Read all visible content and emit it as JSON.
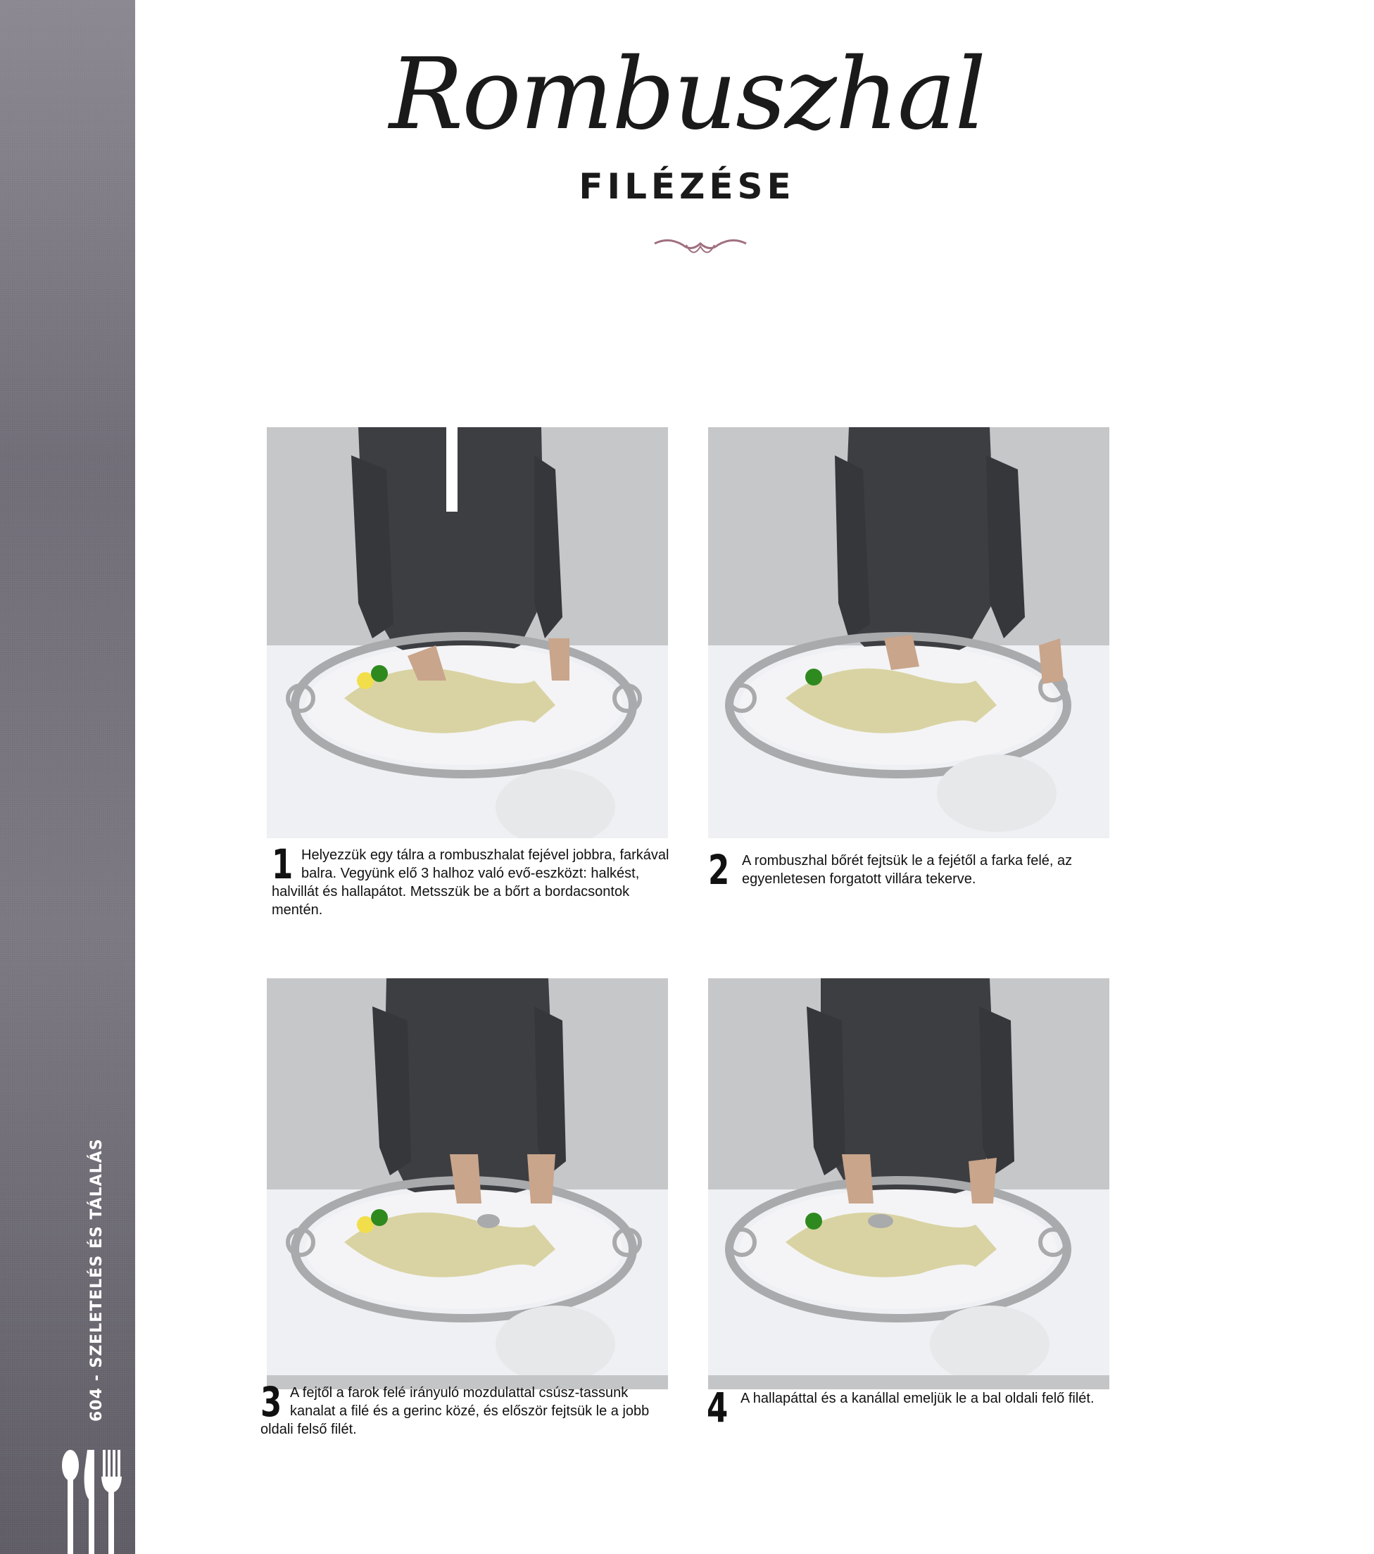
{
  "title": {
    "script": "Rombuszhal",
    "sub": "FILÉZÉSE"
  },
  "side_label": "604 - SZELETELÉS ÉS TÁLALÁS",
  "steps": [
    {
      "num": "1",
      "text": "Helyezzük egy tálra a rombuszhalat fejével jobbra, farkával balra. Vegyünk elő 3 halhoz való evő-eszközt: halkést, halvillát és hallapátot. Metsszük be a bőrt a bordacsontok mentén."
    },
    {
      "num": "2",
      "text": "A rombuszhal bőrét fejtsük le a fejétől a farka felé, az egyenletesen forgatott villára tekerve."
    },
    {
      "num": "3",
      "text": "A fejtől a farok felé irányuló mozdulattal csúsz-tassunk kanalat a filé és a gerinc közé, és először fejtsük le a jobb oldali felső filét."
    },
    {
      "num": "4",
      "text": "A hallapáttal és a kanállal emeljük le a bal oldali felő filét."
    }
  ],
  "colors": {
    "band": "#77737c",
    "suit": "#3d3e42",
    "background": "#c3c5c7",
    "tablecloth": "#eef0f3",
    "fish": "#d9d3a3"
  }
}
